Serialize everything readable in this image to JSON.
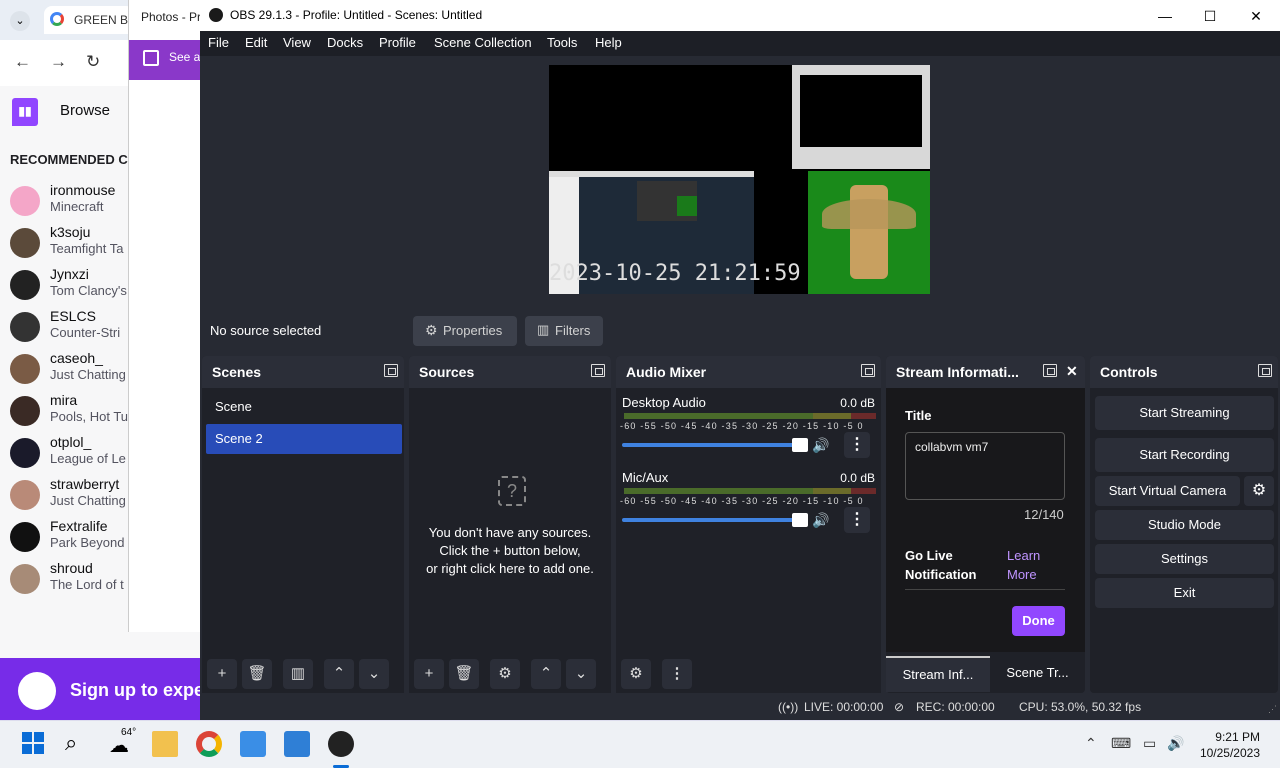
{
  "chrome": {
    "tab_title": "GREEN BO",
    "twitch": {
      "browse_label": "Browse",
      "recommended_label": "RECOMMENDED C",
      "channels": [
        {
          "name": "ironmouse",
          "game": "Minecraft",
          "color": "#f4a6c8"
        },
        {
          "name": "k3soju",
          "game": "Teamfight Ta",
          "color": "#5b4a3a"
        },
        {
          "name": "Jynxzi",
          "game": "Tom Clancy's",
          "color": "#222222"
        },
        {
          "name": "ESLCS",
          "game": "Counter-Stri",
          "color": "#333333"
        },
        {
          "name": "caseoh_",
          "game": "Just Chatting",
          "color": "#7a5b45"
        },
        {
          "name": "mira",
          "game": "Pools, Hot Tu",
          "color": "#3a2a25"
        },
        {
          "name": "otplol_",
          "game": "League of Le",
          "color": "#1a1a2a"
        },
        {
          "name": "strawberryt",
          "game": "Just Chatting",
          "color": "#b98a78"
        },
        {
          "name": "Fextralife",
          "game": "Park Beyond",
          "color": "#111111"
        },
        {
          "name": "shroud",
          "game": "The Lord of t",
          "color": "#a78b77"
        }
      ],
      "signup_label": "Sign up to expe"
    }
  },
  "photos": {
    "title": "Photos - Pr",
    "banner": "See al"
  },
  "obs": {
    "window_title": "OBS 29.1.3 - Profile: Untitled - Scenes: Untitled",
    "menu": [
      "File",
      "Edit",
      "View",
      "Docks",
      "Profile",
      "Scene Collection",
      "Tools",
      "Help"
    ],
    "preview_timestamp": "2023-10-25 21:21:59",
    "no_source": "No source selected",
    "properties_label": "Properties",
    "filters_label": "Filters",
    "scenes": {
      "title": "Scenes",
      "items": [
        "Scene",
        "Scene 2"
      ],
      "selected": "Scene 2"
    },
    "sources": {
      "title": "Sources",
      "empty_line1": "You don't have any sources.",
      "empty_line2": "Click the + button below,",
      "empty_line3": "or right click here to add one."
    },
    "audio": {
      "title": "Audio Mixer",
      "ticks": "-60 -55 -50 -45 -40 -35 -30 -25 -20 -15 -10 -5 0",
      "channels": [
        {
          "name": "Desktop Audio",
          "db": "0.0 dB"
        },
        {
          "name": "Mic/Aux",
          "db": "0.0 dB"
        }
      ]
    },
    "stream_info": {
      "title": "Stream Informati...",
      "title_label": "Title",
      "title_value": "collabvm vm7",
      "char_count": "12/140",
      "go_live_label": "Go Live Notification",
      "learn_more": "Learn More",
      "done_label": "Done",
      "tab1": "Stream Inf...",
      "tab2": "Scene Tr..."
    },
    "controls": {
      "title": "Controls",
      "start_streaming": "Start Streaming",
      "start_recording": "Start Recording",
      "start_virtual_camera": "Start Virtual Camera",
      "studio_mode": "Studio Mode",
      "settings": "Settings",
      "exit": "Exit"
    },
    "status": {
      "live": "LIVE: 00:00:00",
      "rec": "REC: 00:00:00",
      "cpu": "CPU: 53.0%, 50.32 fps"
    }
  },
  "taskbar": {
    "weather": "64°",
    "time": "9:21 PM",
    "date": "10/25/2023"
  }
}
